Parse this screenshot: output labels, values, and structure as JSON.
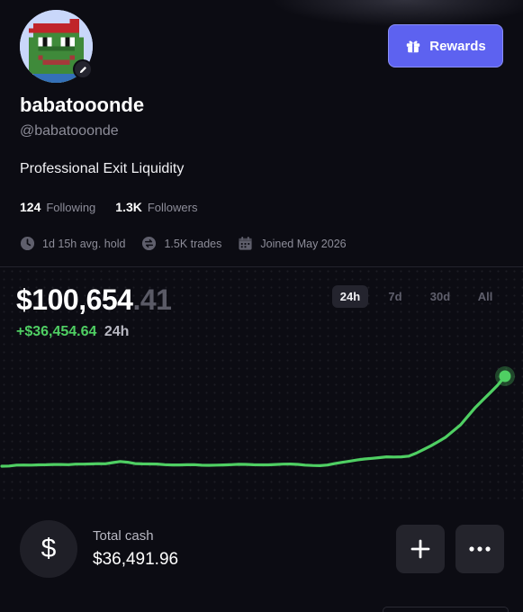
{
  "profile": {
    "username": "babatooonde",
    "handle": "@babatooonde",
    "bio": "Professional Exit Liquidity",
    "following_count": "124",
    "following_label": "Following",
    "followers_count": "1.3K",
    "followers_label": "Followers",
    "avg_hold": "1d 15h avg. hold",
    "trades": "1.5K trades",
    "joined": "Joined May 2026"
  },
  "header": {
    "rewards_label": "Rewards"
  },
  "portfolio": {
    "balance_main": "$100,654",
    "balance_cents": ".41",
    "change_amount": "+$36,454.64",
    "change_period": "24h",
    "ranges": [
      "24h",
      "7d",
      "30d",
      "All"
    ],
    "active_range": "24h",
    "chart_values": [
      64226,
      64302,
      64680,
      64705,
      64660,
      64760,
      64810,
      64905,
      64930,
      64845,
      65050,
      65080,
      65150,
      65260,
      65200,
      65680,
      66120,
      65820,
      65280,
      65190,
      65130,
      65100,
      64850,
      64725,
      64750,
      64800,
      64850,
      64640,
      64600,
      64650,
      64720,
      64860,
      65000,
      64950,
      64800,
      64760,
      64780,
      64900,
      65050,
      65100,
      64950,
      64650,
      64500,
      64460,
      64700,
      65300,
      65800,
      66250,
      66750,
      67150,
      67400,
      67700,
      68000,
      67950,
      68000,
      68300,
      69500,
      71000,
      72500,
      74200,
      76000,
      78500,
      81000,
      84500,
      88000,
      91000,
      94000,
      97000,
      100654.41
    ]
  },
  "cash": {
    "label": "Total cash",
    "value": "$36,491.96",
    "icon": "dollar-icon",
    "symbol": "$"
  },
  "colors": {
    "accent": "#5d62f0",
    "positive": "#4fcf63",
    "background": "#0c0c13"
  }
}
